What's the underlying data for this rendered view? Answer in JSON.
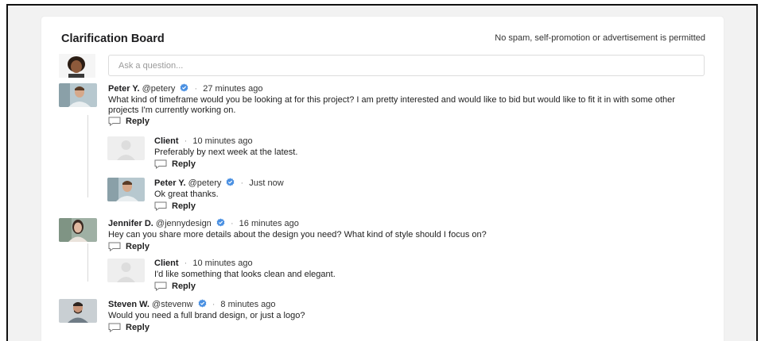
{
  "board": {
    "title": "Clarification Board",
    "notice": "No spam, self-promotion or advertisement is permitted",
    "ask_placeholder": "Ask a question..."
  },
  "icons": {
    "verified": "verified-badge-icon",
    "reply": "speech-bubble-icon"
  },
  "colors": {
    "verified": "#4a90e2",
    "thread_line": "#d9d9d9"
  },
  "comments": [
    {
      "author": "Peter Y.",
      "handle": "@petery",
      "time": "27 minutes ago",
      "text": "What kind of timeframe would you be looking at for this project? I am pretty interested and would like to bid but would like to fit it in with some other projects I'm currently working on.",
      "reply_label": "Reply",
      "replies": [
        {
          "author": "Client",
          "time": "10 minutes ago",
          "text": "Preferably by next week at the latest.",
          "reply_label": "Reply"
        },
        {
          "author": "Peter Y.",
          "handle": "@petery",
          "time": "Just now",
          "text": "Ok great thanks.",
          "reply_label": "Reply"
        }
      ]
    },
    {
      "author": "Jennifer D.",
      "handle": "@jennydesign",
      "time": "16 minutes ago",
      "text": "Hey can you share more details about the design you need? What kind of style should I focus on?",
      "reply_label": "Reply",
      "replies": [
        {
          "author": "Client",
          "time": "10 minutes ago",
          "text": "I'd like something that looks clean and elegant.",
          "reply_label": "Reply"
        }
      ]
    },
    {
      "author": "Steven W.",
      "handle": "@stevenw",
      "time": "8 minutes ago",
      "text": "Would you need a full brand design, or just a logo?",
      "reply_label": "Reply",
      "replies": []
    }
  ],
  "separator": "·"
}
